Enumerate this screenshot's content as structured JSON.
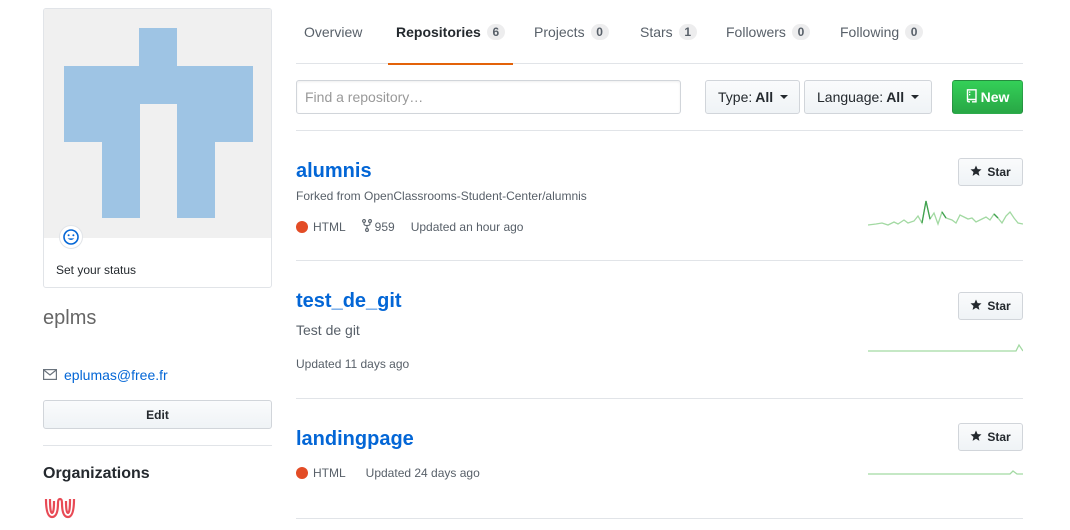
{
  "profile": {
    "status_text": "Set your status",
    "username": "eplms",
    "email": "eplumas@free.fr",
    "edit_label": "Edit",
    "organizations_title": "Organizations"
  },
  "tabs": [
    {
      "label": "Overview",
      "count": null
    },
    {
      "label": "Repositories",
      "count": "6"
    },
    {
      "label": "Projects",
      "count": "0"
    },
    {
      "label": "Stars",
      "count": "1"
    },
    {
      "label": "Followers",
      "count": "0"
    },
    {
      "label": "Following",
      "count": "0"
    }
  ],
  "filters": {
    "search_placeholder": "Find a repository…",
    "type_label": "Type:",
    "type_value": "All",
    "language_label": "Language:",
    "language_value": "All",
    "new_label": "New"
  },
  "repos": [
    {
      "name": "alumnis",
      "description": "Forked from OpenClassrooms-Student-Center/alumnis",
      "language": "HTML",
      "forks": "959",
      "updated": "Updated an hour ago",
      "star_label": "Star"
    },
    {
      "name": "test_de_git",
      "description": "Test de git",
      "updated": "Updated 11 days ago",
      "star_label": "Star"
    },
    {
      "name": "landingpage",
      "language": "HTML",
      "updated": "Updated 24 days ago",
      "star_label": "Star"
    }
  ],
  "colors": {
    "link": "#0366d6",
    "html_language": "#e34c26",
    "tab_underline": "#e36209",
    "new_button": "#28a745",
    "avatar": "#9ec4e4",
    "sparkline": "#a2d9a2"
  }
}
